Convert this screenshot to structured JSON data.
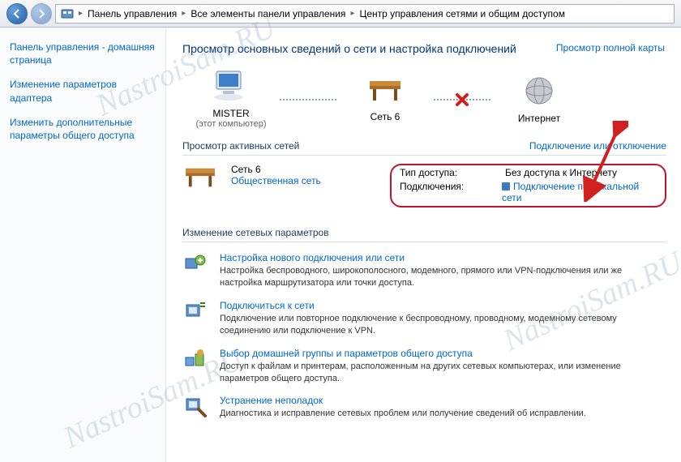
{
  "watermark": "NastroiSam.RU",
  "addressbar": {
    "crumbs": [
      "Панель управления",
      "Все элементы панели управления",
      "Центр управления сетями и общим доступом"
    ]
  },
  "sidebar": {
    "items": [
      "Панель управления - домашняя страница",
      "Изменение параметров адаптера",
      "Изменить дополнительные параметры общего доступа"
    ]
  },
  "heading": "Просмотр основных сведений о сети и настройка подключений",
  "map_link": "Просмотр полной карты",
  "diagram": {
    "nodes": [
      {
        "label": "MISTER",
        "sub": "(этот компьютер)"
      },
      {
        "label": "Сеть 6",
        "sub": ""
      },
      {
        "label": "Интернет",
        "sub": ""
      }
    ]
  },
  "active_header": {
    "left": "Просмотр активных сетей",
    "right": "Подключение или отключение"
  },
  "active_net": {
    "name": "Сеть 6",
    "type": "Общественная сеть",
    "props": [
      {
        "k": "Тип доступа:",
        "v": "Без доступа к Интернету",
        "link": false
      },
      {
        "k": "Подключения:",
        "v": "Подключение по локальной сети",
        "link": true
      }
    ]
  },
  "settings_header": "Изменение сетевых параметров",
  "tasks": [
    {
      "title": "Настройка нового подключения или сети",
      "desc": "Настройка беспроводного, широкополосного, модемного, прямого или VPN-подключения или же настройка маршрутизатора или точки доступа."
    },
    {
      "title": "Подключиться к сети",
      "desc": "Подключение или повторное подключение к беспроводному, проводному, модемному сетевому соединению или подключение к VPN."
    },
    {
      "title": "Выбор домашней группы и параметров общего доступа",
      "desc": "Доступ к файлам и принтерам, расположенным на других сетевых компьютерах, или изменение параметров общего доступа."
    },
    {
      "title": "Устранение неполадок",
      "desc": "Диагностика и исправление сетевых проблем или получение сведений об исправлении."
    }
  ]
}
